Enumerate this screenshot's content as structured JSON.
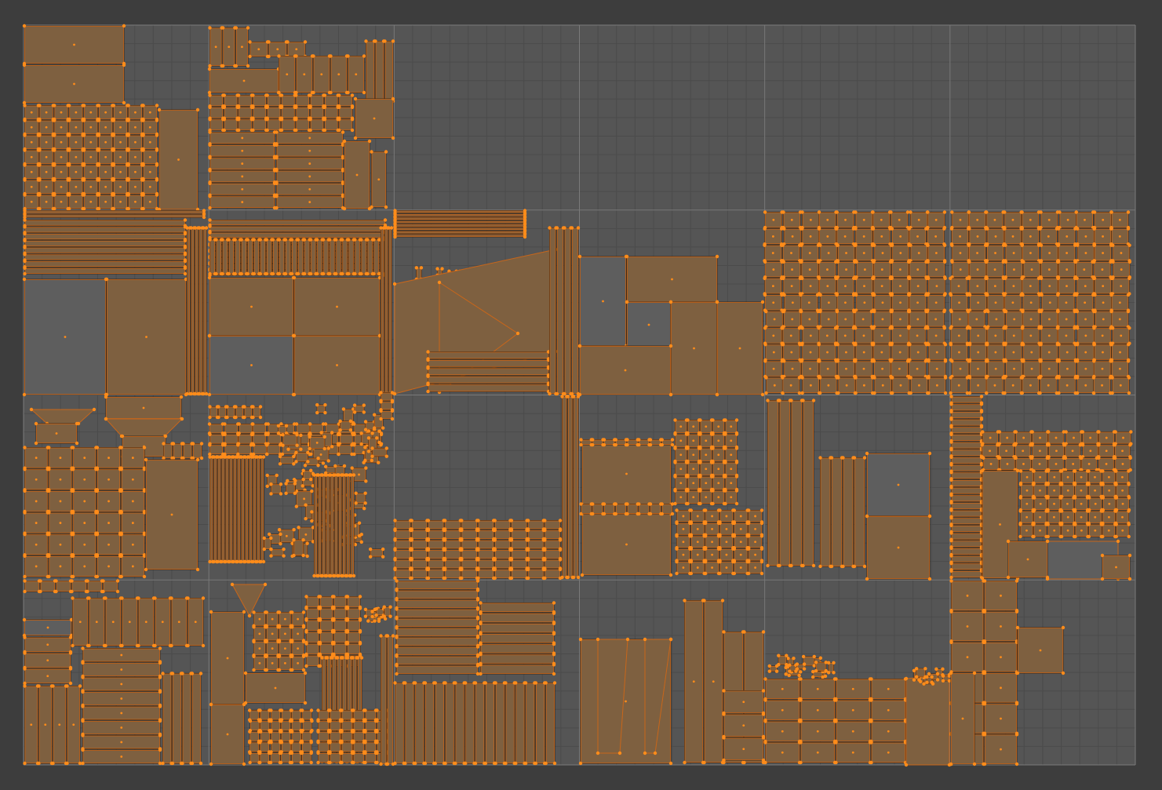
{
  "editor": {
    "name": "UV Editor",
    "mode": "edit",
    "select_mode": "vertex"
  },
  "theme": {
    "background": "#3d3d3d",
    "udim_tile_bg": "#555555",
    "grid_minor": "#4b4b4b",
    "grid_major": "#7a7a7a",
    "face_fill": "#7e6040",
    "face_unfilled": "#5e5e5e",
    "edge": "#c8661a",
    "edge_dark": "#3a2a1a",
    "vertex": "#ff8c1a"
  },
  "udim_grid": {
    "columns": 6,
    "rows": 4,
    "minor_divisions": 10
  },
  "vertex_icon": "vertex-dot-icon",
  "face_dot_icon": "face-center-dot-icon"
}
